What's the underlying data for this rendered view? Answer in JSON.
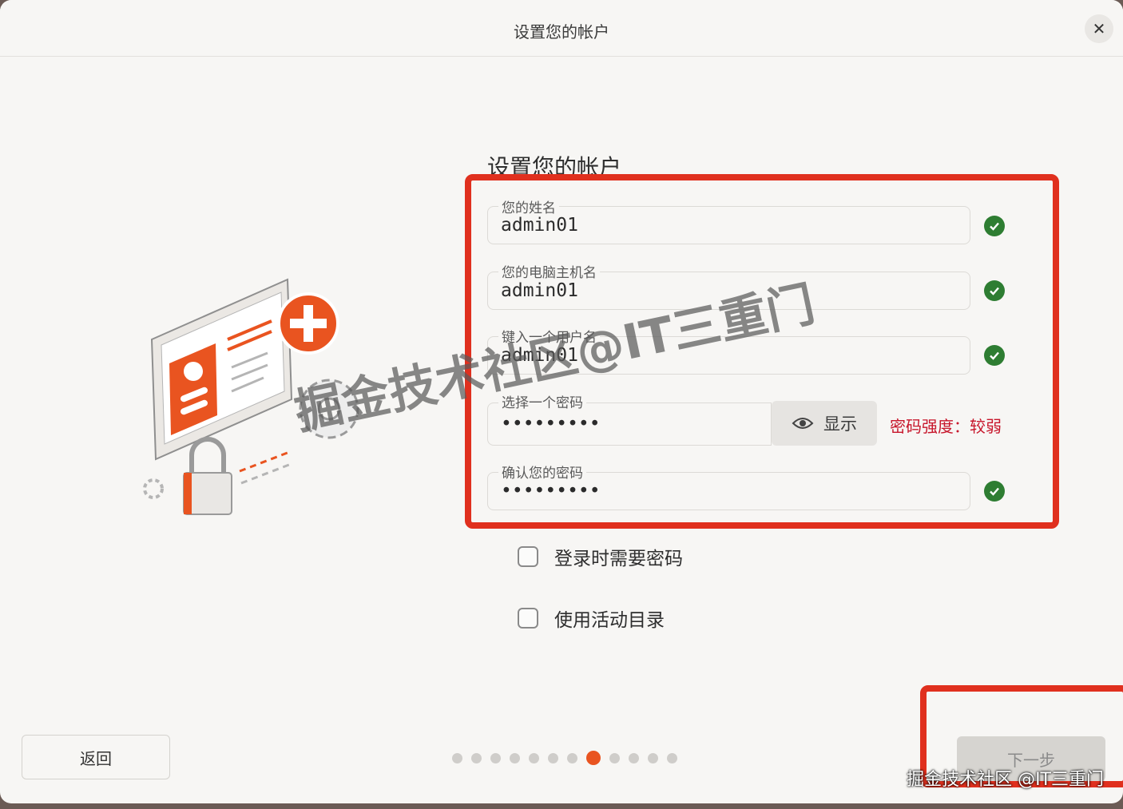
{
  "window": {
    "title": "设置您的帐户",
    "close_icon": "close-icon"
  },
  "form": {
    "heading": "设置您的帐户",
    "fields": [
      {
        "label": "您的姓名",
        "value": "admin01",
        "valid": true
      },
      {
        "label": "您的电脑主机名",
        "value": "admin01",
        "valid": true
      },
      {
        "label": "键入一个用户名",
        "value": "admin01",
        "valid": true
      },
      {
        "label": "选择一个密码",
        "value": "•••••••••"
      },
      {
        "label": "确认您的密码",
        "value": "•••••••••",
        "valid": true
      }
    ],
    "show_password_label": "显示",
    "strength_text": "密码强度：较弱"
  },
  "options": [
    {
      "label": "登录时需要密码",
      "checked": false
    },
    {
      "label": "使用活动目录",
      "checked": false
    }
  ],
  "footer": {
    "back_label": "返回",
    "next_label": "下一步",
    "progress": {
      "total": 12,
      "current": 8
    }
  },
  "watermarks": {
    "overlay": "掘金技术社区@IT三重门",
    "corner": "掘金技术社区 @IT三重门"
  },
  "colors": {
    "accent": "#e95420",
    "valid": "#2e7d32",
    "warning": "#c7162b",
    "highlight": "#e0301e"
  }
}
